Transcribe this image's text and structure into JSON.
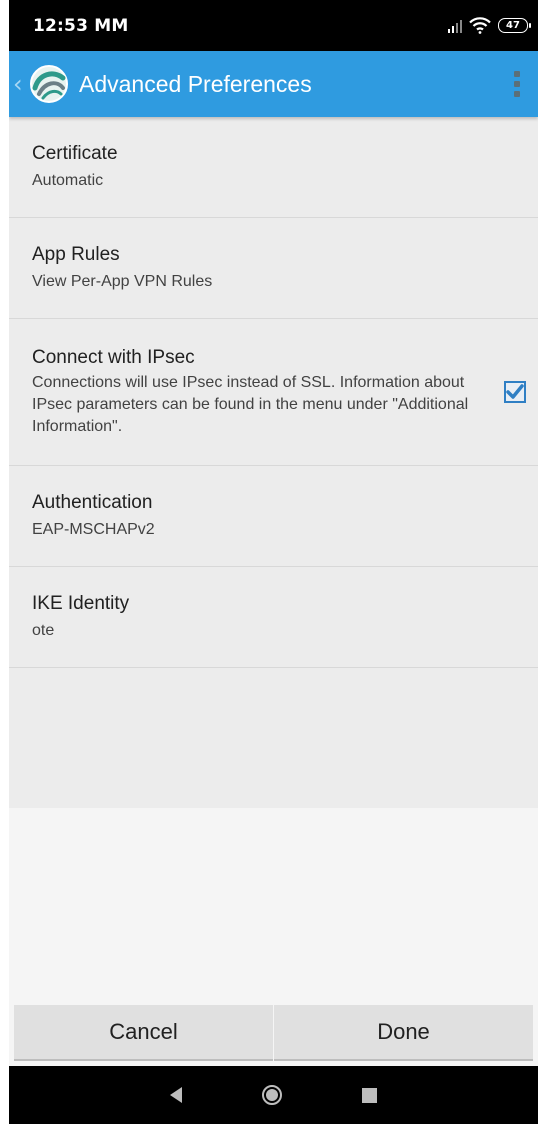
{
  "status_bar": {
    "time": "12:53 MM",
    "battery": "47"
  },
  "toolbar": {
    "title": "Advanced Preferences",
    "back_icon": "chevron-left-icon",
    "menu_icon": "overflow-menu-icon"
  },
  "preferences": [
    {
      "title": "Certificate",
      "summary": "Automatic"
    },
    {
      "title": "App Rules",
      "summary": "View Per-App VPN Rules"
    },
    {
      "title": "Connect with IPsec",
      "summary": "Connections will use IPsec instead of SSL. Information about IPsec parameters can be found in the menu under \"Additional Information\".",
      "checked": true
    },
    {
      "title": "Authentication",
      "summary": "EAP-MSCHAPv2"
    },
    {
      "title": "IKE Identity",
      "summary": "ote"
    }
  ],
  "buttons": {
    "cancel": "Cancel",
    "done": "Done"
  },
  "colors": {
    "toolbar": "#2f9be0",
    "checkbox": "#2f7fc4"
  }
}
